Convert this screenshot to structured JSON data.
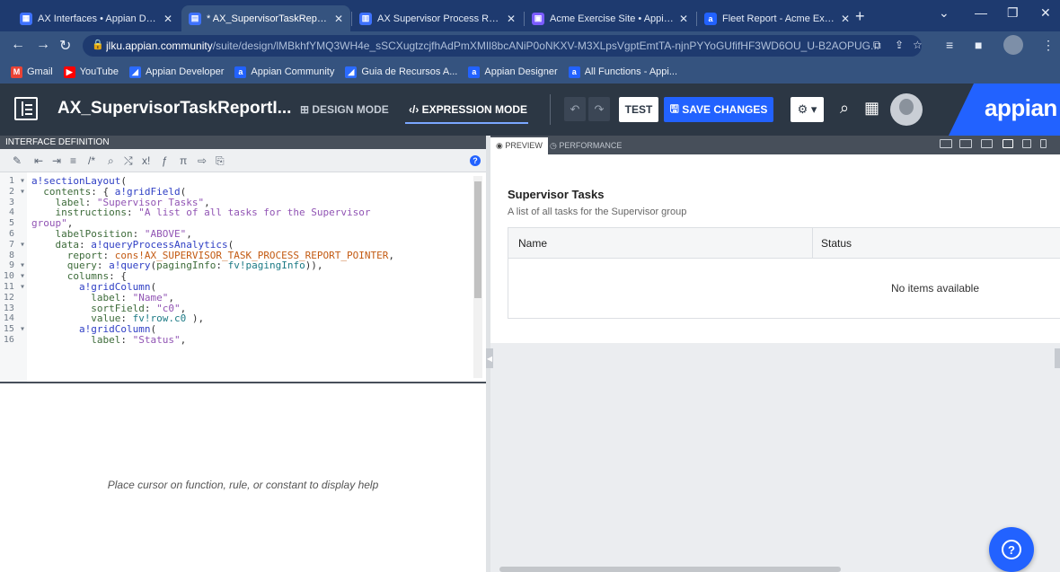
{
  "browser": {
    "tabs": [
      {
        "title": "AX Interfaces • Appian Design",
        "icon": "appian-interface-icon",
        "color": "#3e72ff",
        "glyph": "▦"
      },
      {
        "title": "* AX_SupervisorTaskReportInt",
        "icon": "appian-interface-icon",
        "color": "#3e72ff",
        "glyph": "▤"
      },
      {
        "title": "AX Supervisor Process Report",
        "icon": "report-icon",
        "color": "#3e72ff",
        "glyph": "▥"
      },
      {
        "title": "Acme Exercise Site • Appian",
        "icon": "site-icon",
        "color": "#7a5cff",
        "glyph": "▣"
      },
      {
        "title": "Fleet Report - Acme Exercise",
        "icon": "appian-a-icon",
        "color": "#2262ff",
        "glyph": "a"
      }
    ],
    "url_host": "jlku.appian.community",
    "url_path": "/suite/design/lMBkhfYMQ3WH4e_sSCXugtzcjfhAdPmXMIl8bcANiP0oNKXV-M3XLpsVgptEmtTA-njnPYYoGUfifHF3WD6OU_U-B2AOPUG...",
    "bookmarks": [
      {
        "label": "Gmail",
        "color": "#ea4335",
        "glyph": "M"
      },
      {
        "label": "YouTube",
        "color": "#ff0000",
        "glyph": "▶"
      },
      {
        "label": "Appian Developer",
        "color": "#2b6bff",
        "glyph": "◢"
      },
      {
        "label": "Appian Community",
        "color": "#2262ff",
        "glyph": "a"
      },
      {
        "label": "Guia de Recursos A...",
        "color": "#2b6bff",
        "glyph": "◢"
      },
      {
        "label": "Appian Designer",
        "color": "#2262ff",
        "glyph": "a"
      },
      {
        "label": "All Functions - Appi...",
        "color": "#2262ff",
        "glyph": "a"
      }
    ]
  },
  "header": {
    "title": "AX_SupervisorTaskReportI...",
    "design_mode": "DESIGN MODE",
    "expression_mode": "EXPRESSION MODE",
    "test": "TEST",
    "save": "SAVE CHANGES",
    "brand": "appian",
    "brand_color": "#2262ff"
  },
  "editor": {
    "pane_title": "INTERFACE DEFINITION",
    "lines": [
      {
        "n": "1",
        "fold": true,
        "html": "<span class='k-fn'>a!sectionLayout</span>("
      },
      {
        "n": "2",
        "fold": true,
        "html": "  <span class='k-key'>contents</span>: { <span class='k-fn'>a!gridField</span>("
      },
      {
        "n": "3",
        "fold": false,
        "html": "    <span class='k-key'>label</span>: <span class='k-str'>\"Supervisor Tasks\"</span>,"
      },
      {
        "n": "4",
        "fold": false,
        "html": "    <span class='k-key'>instructions</span>: <span class='k-str'>\"A list of all tasks for the Supervisor</span>"
      },
      {
        "n": "5",
        "fold": false,
        "html": "<span class='k-str'>group\"</span>,"
      },
      {
        "n": "6",
        "fold": false,
        "html": "    <span class='k-key'>labelPosition</span>: <span class='k-str'>\"ABOVE\"</span>,"
      },
      {
        "n": "7",
        "fold": true,
        "html": "    <span class='k-key'>data</span>: <span class='k-fn'>a!queryProcessAnalytics</span>("
      },
      {
        "n": "8",
        "fold": false,
        "html": "      <span class='k-key'>report</span>: <span class='k-cons'>cons!AX_SUPERVISOR_TASK_PROCESS_REPORT_POINTER</span>,"
      },
      {
        "n": "9",
        "fold": true,
        "html": "      <span class='k-key'>query</span>: <span class='k-fn'>a!query</span>(<span class='k-key'>pagingInfo</span>: <span class='k-fv'>fv!pagingInfo</span>)),"
      },
      {
        "n": "10",
        "fold": true,
        "html": "      <span class='k-key'>columns</span>: {"
      },
      {
        "n": "11",
        "fold": true,
        "html": "        <span class='k-fn'>a!gridColumn</span>("
      },
      {
        "n": "12",
        "fold": false,
        "html": "          <span class='k-key'>label</span>: <span class='k-str'>\"Name\"</span>,"
      },
      {
        "n": "13",
        "fold": false,
        "html": "          <span class='k-key'>sortField</span>: <span class='k-str'>\"c0\"</span>,"
      },
      {
        "n": "14",
        "fold": false,
        "html": "          <span class='k-key'>value</span>: <span class='k-fv'>fv!row.c0</span> ),"
      },
      {
        "n": "15",
        "fold": true,
        "html": "        <span class='k-fn'>a!gridColumn</span>("
      },
      {
        "n": "16",
        "fold": false,
        "html": "          <span class='k-key'>label</span>: <span class='k-str'>\"Status\"</span>,"
      }
    ],
    "help_text": "Place cursor on function, rule, or constant to display help"
  },
  "preview": {
    "tab_preview": "PREVIEW",
    "tab_performance": "PERFORMANCE",
    "section_label": "Supervisor Tasks",
    "instructions": "A list of all tasks for the Supervisor group",
    "col_name": "Name",
    "col_status": "Status",
    "empty": "No items available"
  }
}
